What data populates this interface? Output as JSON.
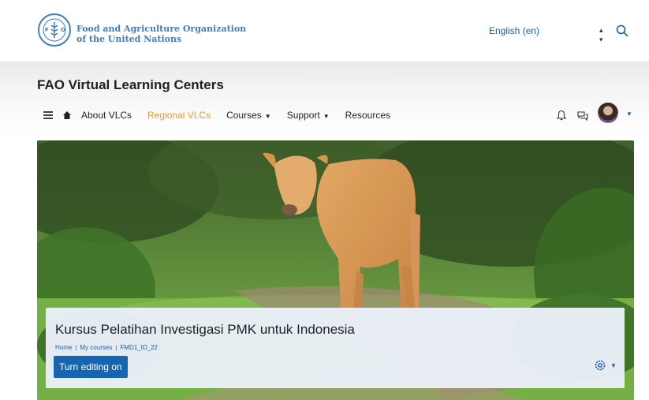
{
  "org": {
    "name_line1": "Food and Agriculture Organization",
    "name_line2": "of the United Nations",
    "logo_icon": "fao-logo-icon"
  },
  "language": {
    "selected": "English (en)"
  },
  "site": {
    "title": "FAO Virtual Learning Centers"
  },
  "nav": {
    "items": [
      {
        "label": "About VLCs",
        "active": false,
        "dropdown": false
      },
      {
        "label": "Regional VLCs",
        "active": true,
        "dropdown": false
      },
      {
        "label": "Courses",
        "active": false,
        "dropdown": true
      },
      {
        "label": "Support",
        "active": false,
        "dropdown": true
      },
      {
        "label": "Resources",
        "active": false,
        "dropdown": false
      }
    ]
  },
  "user_menu": {
    "notification_icon": "bell-icon",
    "message_icon": "chat-icon",
    "avatar_icon": "avatar"
  },
  "course": {
    "title": "Kursus Pelatihan Investigasi PMK untuk Indonesia",
    "breadcrumb": [
      "Home",
      "My courses",
      "FMD1_ID_22"
    ],
    "edit_button": "Turn editing on"
  },
  "colors": {
    "brand_blue": "#1565b0",
    "active_nav": "#e79b3e",
    "link": "#1f5ea8"
  }
}
